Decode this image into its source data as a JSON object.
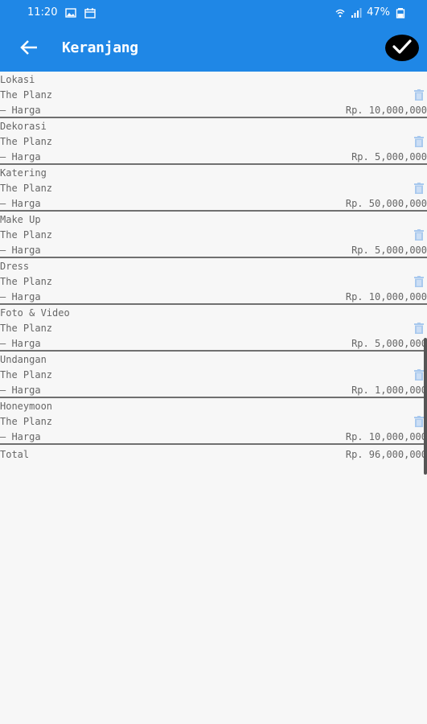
{
  "status_bar": {
    "time": "11:20",
    "battery": "47%",
    "left_icons": [
      "image-icon",
      "calendar-icon"
    ],
    "right_icons": [
      "wifi-icon",
      "signal-icon",
      "battery-icon"
    ]
  },
  "app_bar": {
    "title": "Keranjang",
    "back_icon": "arrow-left-icon",
    "confirm_icon": "check-icon"
  },
  "items": [
    {
      "category": "Lokasi",
      "vendor": "The Planz",
      "harga_label": "— Harga",
      "price": "Rp. 10,000,000"
    },
    {
      "category": "Dekorasi",
      "vendor": "The Planz",
      "harga_label": "— Harga",
      "price": "Rp. 5,000,000"
    },
    {
      "category": "Katering",
      "vendor": "The Planz",
      "harga_label": "— Harga",
      "price": "Rp. 50,000,000"
    },
    {
      "category": "Make Up",
      "vendor": "The Planz",
      "harga_label": "— Harga",
      "price": "Rp. 5,000,000"
    },
    {
      "category": "Dress",
      "vendor": "The Planz",
      "harga_label": "— Harga",
      "price": "Rp. 10,000,000"
    },
    {
      "category": "Foto & Video",
      "vendor": "The Planz",
      "harga_label": "— Harga",
      "price": "Rp. 5,000,000"
    },
    {
      "category": "Undangan",
      "vendor": "The Planz",
      "harga_label": "— Harga",
      "price": "Rp. 1,000,000"
    },
    {
      "category": "Honeymoon",
      "vendor": "The Planz",
      "harga_label": "— Harga",
      "price": "Rp. 10,000,000"
    }
  ],
  "total": {
    "label": "Total",
    "value": "Rp. 96,000,000"
  },
  "colors": {
    "primary": "#1f87e6",
    "background": "#f7f7f7",
    "text": "#666666",
    "divider": "#707070",
    "trash": "#a9c9ee"
  }
}
